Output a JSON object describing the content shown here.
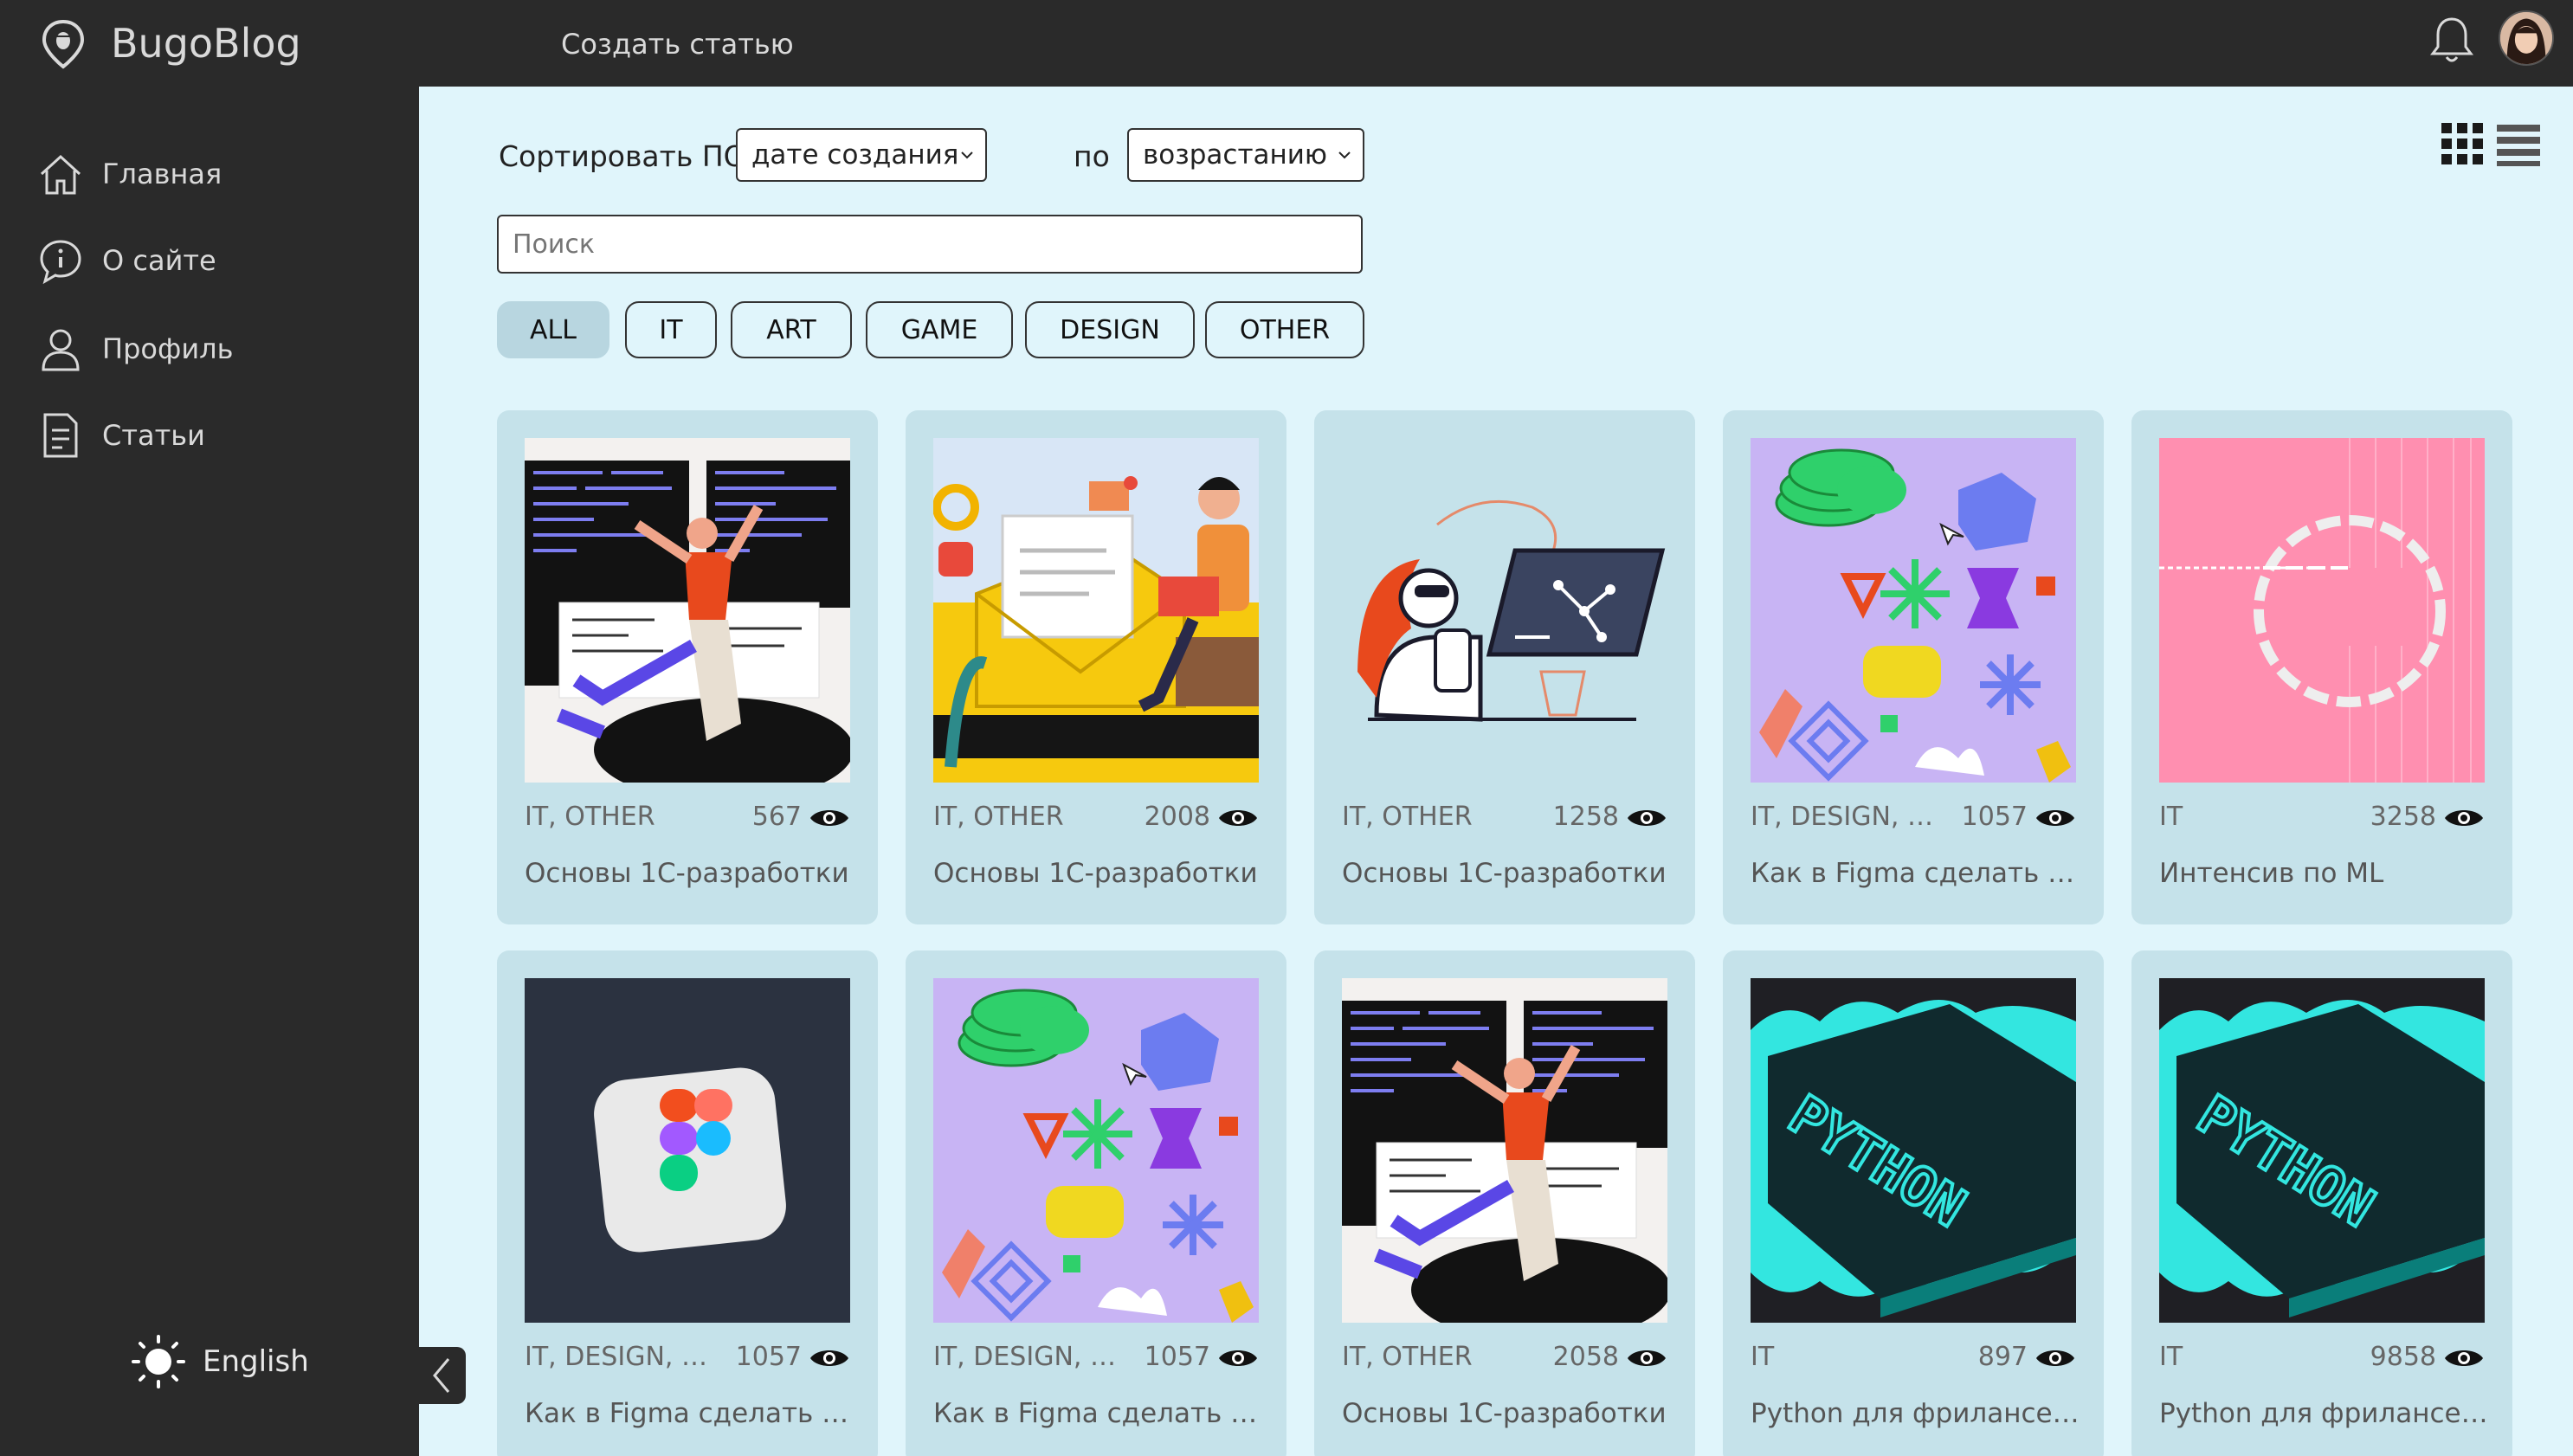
{
  "header": {
    "logo_text": "BugoBlog",
    "create_article": "Создать статью",
    "icons": {
      "logo": "bug-pin-icon",
      "notifications": "bell-icon",
      "user": "avatar"
    }
  },
  "sidebar": {
    "items": [
      {
        "label": "Главная",
        "icon": "home-icon"
      },
      {
        "label": "О сайте",
        "icon": "info-icon"
      },
      {
        "label": "Профиль",
        "icon": "user-icon"
      },
      {
        "label": "Статьи",
        "icon": "document-icon"
      }
    ],
    "language": {
      "label": "English",
      "icon": "sun-icon"
    },
    "collapse_icon": "chevron-left-icon"
  },
  "toolbar": {
    "sort_label": "Сортировать ПО",
    "sort_field": "дате создания",
    "order_label": "по",
    "order_value": "возрастанию",
    "search_placeholder": "Поиск",
    "view_icons": [
      "grid-view-icon",
      "list-view-icon"
    ]
  },
  "filters": [
    "ALL",
    "IT",
    "ART",
    "GAME",
    "DESIGN",
    "OTHER"
  ],
  "active_filter": "ALL",
  "articles": [
    {
      "tags": "IT, OTHER",
      "views": "567",
      "title": "Основы 1С-разработки"
    },
    {
      "tags": "IT, OTHER",
      "views": "2008",
      "title": "Основы 1С-разработки"
    },
    {
      "tags": "IT, OTHER",
      "views": "1258",
      "title": "Основы 1С-разработки"
    },
    {
      "tags": "IT, DESIGN, OTHER",
      "views": "1057",
      "title": "Как в Figma сделать что угодно"
    },
    {
      "tags": "IT",
      "views": "3258",
      "title": "Интенсив по ML"
    },
    {
      "tags": "IT, DESIGN, OTHER",
      "views": "1057",
      "title": "Как в Figma сделать что угодно"
    },
    {
      "tags": "IT, DESIGN, OTHER",
      "views": "1057",
      "title": "Как в Figma сделать что угодно"
    },
    {
      "tags": "IT, OTHER",
      "views": "2058",
      "title": "Основы 1С-разработки"
    },
    {
      "tags": "IT",
      "views": "897",
      "title": "Python для фрилансера"
    },
    {
      "tags": "IT",
      "views": "9858",
      "title": "Python для фрилансера"
    }
  ],
  "colors": {
    "sidebar_bg": "#2a2a2a",
    "main_bg": "#e0f5fb",
    "card_bg": "#c5e2ea",
    "chip_active": "#b8d6e0"
  }
}
